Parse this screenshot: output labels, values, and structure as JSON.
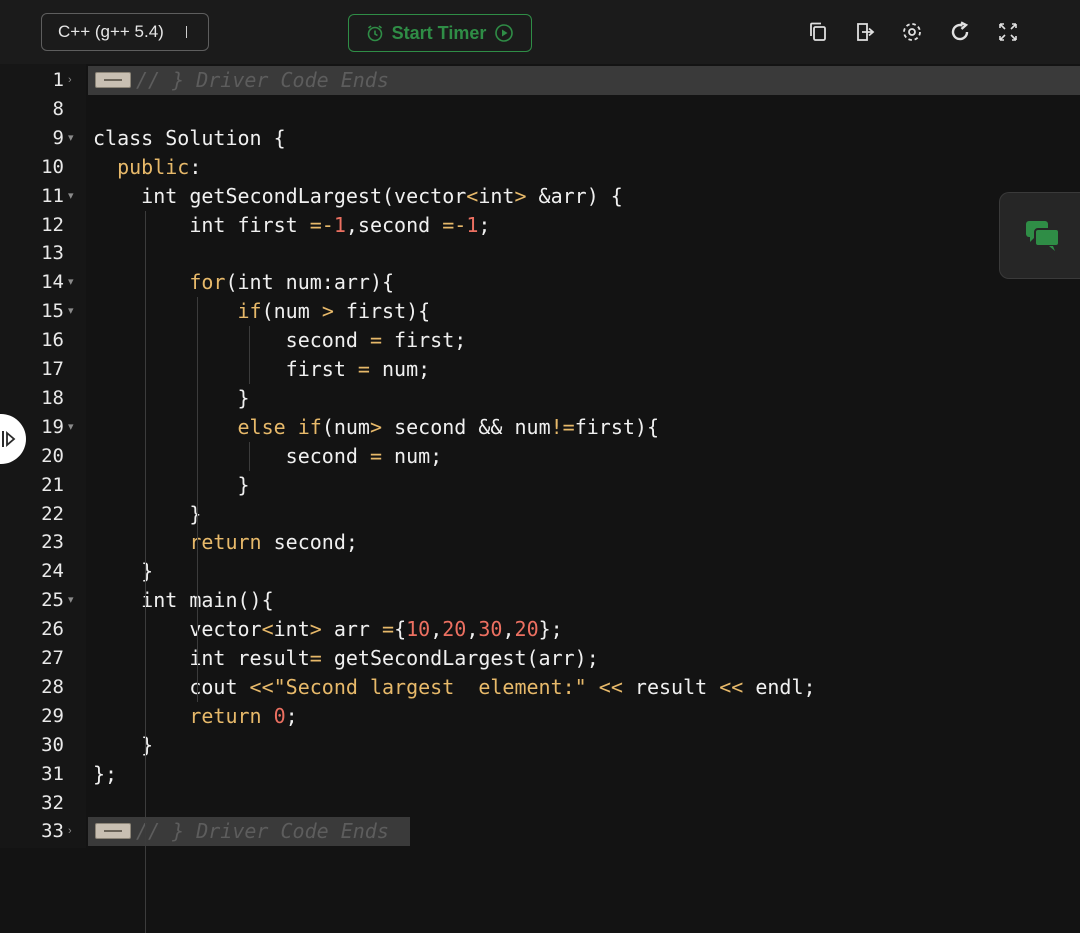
{
  "toolbar": {
    "language": "C++ (g++ 5.4)",
    "timer_label": "Start Timer",
    "icons": [
      "copy-icon",
      "exit-icon",
      "settings-icon",
      "reset-icon",
      "fullscreen-icon"
    ],
    "accent_color": "#2f8d46"
  },
  "editor": {
    "lines": [
      {
        "n": "1",
        "text": "// } Driver Code Ends",
        "fold": true,
        "collapsed": true
      },
      {
        "n": "8",
        "text": ""
      },
      {
        "n": "9",
        "text": "class Solution {",
        "fold": true
      },
      {
        "n": "10",
        "text": "  public:"
      },
      {
        "n": "11",
        "text": "    int getSecondLargest(vector<int> &arr) {",
        "fold": true
      },
      {
        "n": "12",
        "text": "        int first =-1,second =-1;"
      },
      {
        "n": "13",
        "text": ""
      },
      {
        "n": "14",
        "text": "        for(int num:arr){",
        "fold": true
      },
      {
        "n": "15",
        "text": "            if(num > first){",
        "fold": true
      },
      {
        "n": "16",
        "text": "                second = first;"
      },
      {
        "n": "17",
        "text": "                first = num;"
      },
      {
        "n": "18",
        "text": "            }"
      },
      {
        "n": "19",
        "text": "            else if(num> second && num!=first){",
        "fold": true
      },
      {
        "n": "20",
        "text": "                second = num;"
      },
      {
        "n": "21",
        "text": "            }"
      },
      {
        "n": "22",
        "text": "        }"
      },
      {
        "n": "23",
        "text": "        return second;"
      },
      {
        "n": "24",
        "text": "    }"
      },
      {
        "n": "25",
        "text": "    int main(){",
        "fold": true
      },
      {
        "n": "26",
        "text": "        vector<int> arr ={10,20,30,20};"
      },
      {
        "n": "27",
        "text": "        int result= getSecondLargest(arr);"
      },
      {
        "n": "28",
        "text": "        cout <<\"Second largest  element:\" << result << endl;"
      },
      {
        "n": "29",
        "text": "        return 0;"
      },
      {
        "n": "30",
        "text": "    }"
      },
      {
        "n": "31",
        "text": "};"
      },
      {
        "n": "32",
        "text": ""
      },
      {
        "n": "33",
        "text": "// } Driver Code Ends",
        "collapsed": true
      }
    ]
  },
  "side": {
    "chat_icon": "chat-icon",
    "chat_color": "#2f8d46",
    "expand_icon": "expand-panel-icon"
  }
}
